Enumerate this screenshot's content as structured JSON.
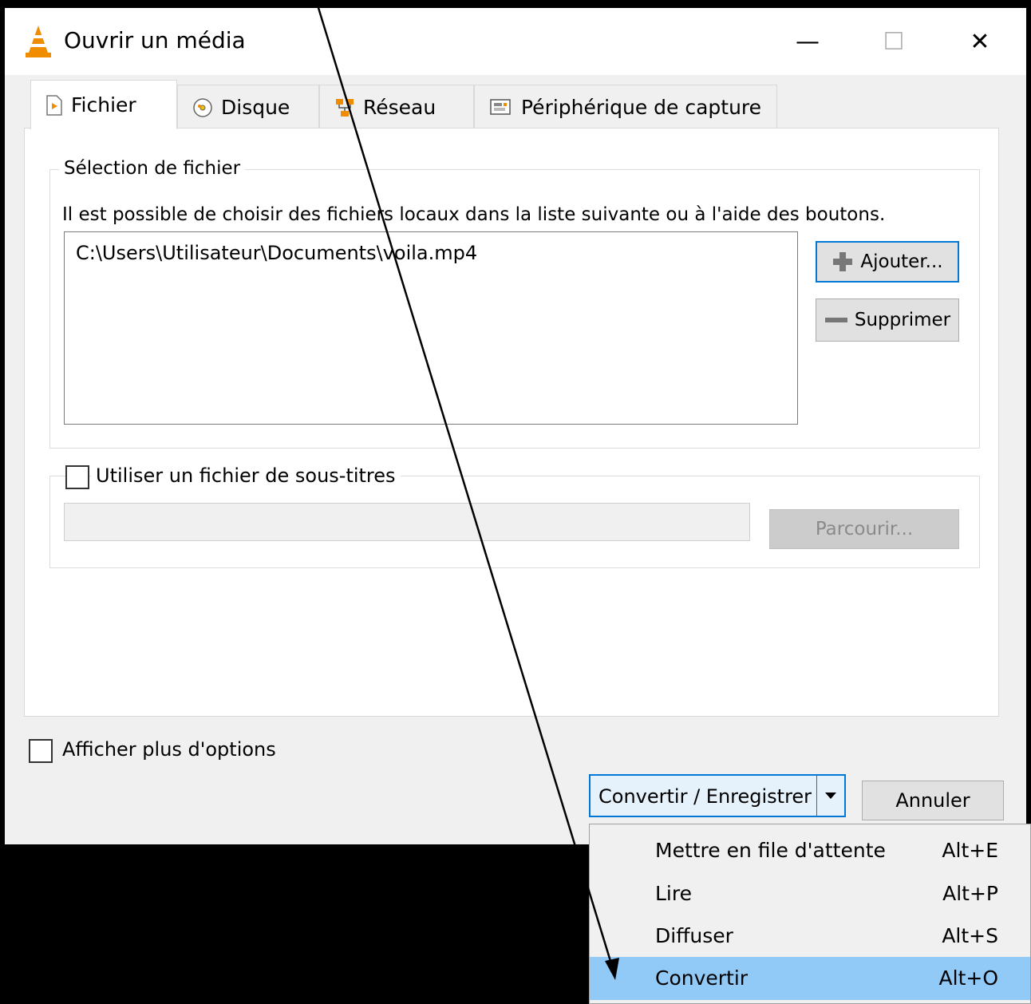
{
  "window": {
    "title": "Ouvrir un média",
    "controls": {
      "minimize": "—",
      "maximize": "☐",
      "close": "✕"
    }
  },
  "tabs": [
    {
      "label": "Fichier",
      "icon": "file-play-icon",
      "active": true
    },
    {
      "label": "Disque",
      "icon": "disc-icon",
      "active": false
    },
    {
      "label": "Réseau",
      "icon": "network-icon",
      "active": false
    },
    {
      "label": "Périphérique de capture",
      "icon": "capture-device-icon",
      "active": false
    }
  ],
  "file_selection": {
    "legend": "Sélection de fichier",
    "description": "Il est possible de choisir des fichiers locaux dans la liste suivante ou à l'aide des boutons.",
    "files": [
      "C:\\Users\\Utilisateur\\Documents\\voila.mp4"
    ],
    "add_button": "Ajouter...",
    "remove_button": "Supprimer"
  },
  "subtitles": {
    "checkbox_label": "Utiliser un fichier de sous-titres",
    "checked": false,
    "path_value": "",
    "browse_button": "Parcourir..."
  },
  "more_options": {
    "label": "Afficher plus d'options",
    "checked": false
  },
  "footer": {
    "primary_button": "Convertir / Enregistrer",
    "cancel_button": "Annuler"
  },
  "dropdown_menu": [
    {
      "label": "Mettre en file d'attente",
      "shortcut": "Alt+E",
      "selected": false
    },
    {
      "label": "Lire",
      "shortcut": "Alt+P",
      "selected": false
    },
    {
      "label": "Diffuser",
      "shortcut": "Alt+S",
      "selected": false
    },
    {
      "label": "Convertir",
      "shortcut": "Alt+O",
      "selected": true
    }
  ],
  "colors": {
    "accent": "#0078d7",
    "menu_selected": "#91c9f7",
    "vlc_orange": "#f08c00"
  }
}
